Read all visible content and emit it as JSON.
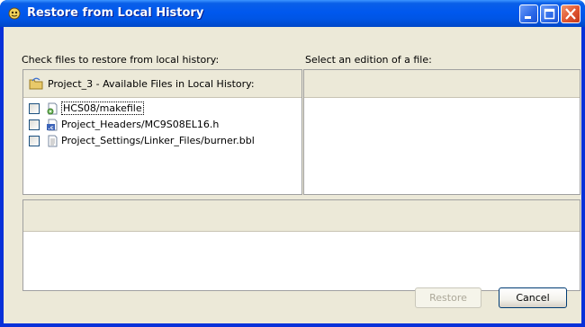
{
  "window": {
    "title": "Restore from Local History",
    "controls": {
      "minimize": "minimize-icon",
      "maximize": "maximize-icon",
      "close": "close-icon"
    }
  },
  "left_pane": {
    "label": "Check files to restore from local history:",
    "header": "Project_3 - Available Files in Local History:",
    "header_icon": "project-folder-icon",
    "files": [
      {
        "name": "HCS08/makefile",
        "icon": "makefile-icon",
        "checked": false
      },
      {
        "name": "Project_Headers/MC9S08EL16.h",
        "icon": "c-header-icon",
        "checked": false
      },
      {
        "name": "Project_Settings/Linker_Files/burner.bbl",
        "icon": "text-file-icon",
        "checked": false
      }
    ]
  },
  "right_pane": {
    "label": "Select an edition of a file:"
  },
  "buttons": {
    "restore": "Restore",
    "cancel": "Cancel"
  },
  "colors": {
    "titlebar": "#0055e5",
    "dialog_bg": "#ece9d8",
    "border": "#a0a0a0"
  }
}
